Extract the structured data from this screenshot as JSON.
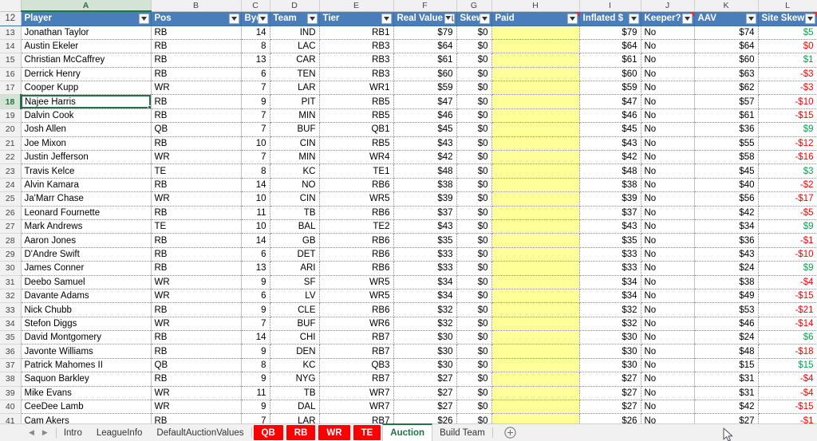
{
  "app": {
    "type": "spreadsheet",
    "selected_cell": "A18",
    "active_column": "A",
    "active_row": "18"
  },
  "colors": {
    "header_blue": "#4a7ebb",
    "paid_yellow": "#ffff99",
    "active_green": "#217346",
    "positive_green": "#00a550",
    "negative_red": "#ff0000",
    "tab_red": "#ff0000"
  },
  "column_letters": [
    "A",
    "B",
    "C",
    "D",
    "E",
    "F",
    "G",
    "H",
    "I",
    "J",
    "K",
    "L"
  ],
  "table": {
    "header_row_number": "12",
    "headers": [
      {
        "label": "Player",
        "filter": "dropdown",
        "comment": false
      },
      {
        "label": "Pos",
        "filter": "dropdown",
        "comment": false
      },
      {
        "label": "Bye",
        "filter": "dropdown",
        "comment": false
      },
      {
        "label": "Team",
        "filter": "dropdown",
        "comment": false
      },
      {
        "label": "Tier",
        "filter": "dropdown",
        "comment": false
      },
      {
        "label": "Real Value",
        "filter": "sort-desc",
        "comment": false
      },
      {
        "label": "Skew",
        "filter": "dropdown",
        "comment": false
      },
      {
        "label": "Paid",
        "filter": "dropdown",
        "comment": true
      },
      {
        "label": "Inflated $",
        "filter": "dropdown",
        "comment": false
      },
      {
        "label": "Keeper?",
        "filter": "dropdown",
        "comment": true
      },
      {
        "label": "AAV",
        "filter": "dropdown",
        "comment": false
      },
      {
        "label": "Site Skew",
        "filter": "dropdown",
        "comment": true
      }
    ],
    "rows": [
      {
        "n": "13",
        "player": "Jonathan Taylor",
        "pos": "RB",
        "bye": "14",
        "team": "IND",
        "tier": "RB1",
        "real": "$79",
        "skew": "$0",
        "paid": "",
        "inflated": "$79",
        "keeper": "No",
        "aav": "$74",
        "site_skew": "$5",
        "site_skew_sign": "pos"
      },
      {
        "n": "14",
        "player": "Austin Ekeler",
        "pos": "RB",
        "bye": "8",
        "team": "LAC",
        "tier": "RB3",
        "real": "$64",
        "skew": "$0",
        "paid": "",
        "inflated": "$64",
        "keeper": "No",
        "aav": "$64",
        "site_skew": "$0",
        "site_skew_sign": "neg"
      },
      {
        "n": "15",
        "player": "Christian McCaffrey",
        "pos": "RB",
        "bye": "13",
        "team": "CAR",
        "tier": "RB3",
        "real": "$61",
        "skew": "$0",
        "paid": "",
        "inflated": "$61",
        "keeper": "No",
        "aav": "$60",
        "site_skew": "$1",
        "site_skew_sign": "pos"
      },
      {
        "n": "16",
        "player": "Derrick Henry",
        "pos": "RB",
        "bye": "6",
        "team": "TEN",
        "tier": "RB3",
        "real": "$60",
        "skew": "$0",
        "paid": "",
        "inflated": "$60",
        "keeper": "No",
        "aav": "$63",
        "site_skew": "-$3",
        "site_skew_sign": "neg"
      },
      {
        "n": "17",
        "player": "Cooper Kupp",
        "pos": "WR",
        "bye": "7",
        "team": "LAR",
        "tier": "WR1",
        "real": "$59",
        "skew": "$0",
        "paid": "",
        "inflated": "$59",
        "keeper": "No",
        "aav": "$62",
        "site_skew": "-$3",
        "site_skew_sign": "neg"
      },
      {
        "n": "18",
        "player": "Najee Harris",
        "pos": "RB",
        "bye": "9",
        "team": "PIT",
        "tier": "RB5",
        "real": "$47",
        "skew": "$0",
        "paid": "",
        "inflated": "$47",
        "keeper": "No",
        "aav": "$57",
        "site_skew": "-$10",
        "site_skew_sign": "neg"
      },
      {
        "n": "19",
        "player": "Dalvin Cook",
        "pos": "RB",
        "bye": "7",
        "team": "MIN",
        "tier": "RB5",
        "real": "$46",
        "skew": "$0",
        "paid": "",
        "inflated": "$46",
        "keeper": "No",
        "aav": "$61",
        "site_skew": "-$15",
        "site_skew_sign": "neg"
      },
      {
        "n": "20",
        "player": "Josh Allen",
        "pos": "QB",
        "bye": "7",
        "team": "BUF",
        "tier": "QB1",
        "real": "$45",
        "skew": "$0",
        "paid": "",
        "inflated": "$45",
        "keeper": "No",
        "aav": "$36",
        "site_skew": "$9",
        "site_skew_sign": "pos"
      },
      {
        "n": "21",
        "player": "Joe Mixon",
        "pos": "RB",
        "bye": "10",
        "team": "CIN",
        "tier": "RB5",
        "real": "$43",
        "skew": "$0",
        "paid": "",
        "inflated": "$43",
        "keeper": "No",
        "aav": "$55",
        "site_skew": "-$12",
        "site_skew_sign": "neg"
      },
      {
        "n": "22",
        "player": "Justin Jefferson",
        "pos": "WR",
        "bye": "7",
        "team": "MIN",
        "tier": "WR4",
        "real": "$42",
        "skew": "$0",
        "paid": "",
        "inflated": "$42",
        "keeper": "No",
        "aav": "$58",
        "site_skew": "-$16",
        "site_skew_sign": "neg"
      },
      {
        "n": "23",
        "player": "Travis Kelce",
        "pos": "TE",
        "bye": "8",
        "team": "KC",
        "tier": "TE1",
        "real": "$48",
        "skew": "$0",
        "paid": "",
        "inflated": "$48",
        "keeper": "No",
        "aav": "$45",
        "site_skew": "$3",
        "site_skew_sign": "pos"
      },
      {
        "n": "24",
        "player": "Alvin Kamara",
        "pos": "RB",
        "bye": "14",
        "team": "NO",
        "tier": "RB6",
        "real": "$38",
        "skew": "$0",
        "paid": "",
        "inflated": "$38",
        "keeper": "No",
        "aav": "$40",
        "site_skew": "-$2",
        "site_skew_sign": "neg"
      },
      {
        "n": "25",
        "player": "Ja'Marr Chase",
        "pos": "WR",
        "bye": "10",
        "team": "CIN",
        "tier": "WR5",
        "real": "$39",
        "skew": "$0",
        "paid": "",
        "inflated": "$39",
        "keeper": "No",
        "aav": "$56",
        "site_skew": "-$17",
        "site_skew_sign": "neg"
      },
      {
        "n": "26",
        "player": "Leonard Fournette",
        "pos": "RB",
        "bye": "11",
        "team": "TB",
        "tier": "RB6",
        "real": "$37",
        "skew": "$0",
        "paid": "",
        "inflated": "$37",
        "keeper": "No",
        "aav": "$42",
        "site_skew": "-$5",
        "site_skew_sign": "neg"
      },
      {
        "n": "27",
        "player": "Mark Andrews",
        "pos": "TE",
        "bye": "10",
        "team": "BAL",
        "tier": "TE2",
        "real": "$43",
        "skew": "$0",
        "paid": "",
        "inflated": "$43",
        "keeper": "No",
        "aav": "$34",
        "site_skew": "$9",
        "site_skew_sign": "pos"
      },
      {
        "n": "28",
        "player": "Aaron Jones",
        "pos": "RB",
        "bye": "14",
        "team": "GB",
        "tier": "RB6",
        "real": "$35",
        "skew": "$0",
        "paid": "",
        "inflated": "$35",
        "keeper": "No",
        "aav": "$36",
        "site_skew": "-$1",
        "site_skew_sign": "neg"
      },
      {
        "n": "29",
        "player": "D'Andre Swift",
        "pos": "RB",
        "bye": "6",
        "team": "DET",
        "tier": "RB6",
        "real": "$33",
        "skew": "$0",
        "paid": "",
        "inflated": "$33",
        "keeper": "No",
        "aav": "$43",
        "site_skew": "-$10",
        "site_skew_sign": "neg"
      },
      {
        "n": "30",
        "player": "James Conner",
        "pos": "RB",
        "bye": "13",
        "team": "ARI",
        "tier": "RB6",
        "real": "$33",
        "skew": "$0",
        "paid": "",
        "inflated": "$33",
        "keeper": "No",
        "aav": "$24",
        "site_skew": "$9",
        "site_skew_sign": "pos"
      },
      {
        "n": "31",
        "player": "Deebo Samuel",
        "pos": "WR",
        "bye": "9",
        "team": "SF",
        "tier": "WR5",
        "real": "$34",
        "skew": "$0",
        "paid": "",
        "inflated": "$34",
        "keeper": "No",
        "aav": "$38",
        "site_skew": "-$4",
        "site_skew_sign": "neg"
      },
      {
        "n": "32",
        "player": "Davante Adams",
        "pos": "WR",
        "bye": "6",
        "team": "LV",
        "tier": "WR5",
        "real": "$34",
        "skew": "$0",
        "paid": "",
        "inflated": "$34",
        "keeper": "No",
        "aav": "$49",
        "site_skew": "-$15",
        "site_skew_sign": "neg"
      },
      {
        "n": "33",
        "player": "Nick Chubb",
        "pos": "RB",
        "bye": "9",
        "team": "CLE",
        "tier": "RB6",
        "real": "$32",
        "skew": "$0",
        "paid": "",
        "inflated": "$32",
        "keeper": "No",
        "aav": "$53",
        "site_skew": "-$21",
        "site_skew_sign": "neg"
      },
      {
        "n": "34",
        "player": "Stefon Diggs",
        "pos": "WR",
        "bye": "7",
        "team": "BUF",
        "tier": "WR6",
        "real": "$32",
        "skew": "$0",
        "paid": "",
        "inflated": "$32",
        "keeper": "No",
        "aav": "$46",
        "site_skew": "-$14",
        "site_skew_sign": "neg"
      },
      {
        "n": "35",
        "player": "David Montgomery",
        "pos": "RB",
        "bye": "14",
        "team": "CHI",
        "tier": "RB7",
        "real": "$30",
        "skew": "$0",
        "paid": "",
        "inflated": "$30",
        "keeper": "No",
        "aav": "$24",
        "site_skew": "$6",
        "site_skew_sign": "pos"
      },
      {
        "n": "36",
        "player": "Javonte Williams",
        "pos": "RB",
        "bye": "9",
        "team": "DEN",
        "tier": "RB7",
        "real": "$30",
        "skew": "$0",
        "paid": "",
        "inflated": "$30",
        "keeper": "No",
        "aav": "$48",
        "site_skew": "-$18",
        "site_skew_sign": "neg"
      },
      {
        "n": "37",
        "player": "Patrick Mahomes II",
        "pos": "QB",
        "bye": "8",
        "team": "KC",
        "tier": "QB3",
        "real": "$30",
        "skew": "$0",
        "paid": "",
        "inflated": "$30",
        "keeper": "No",
        "aav": "$15",
        "site_skew": "$15",
        "site_skew_sign": "pos"
      },
      {
        "n": "38",
        "player": "Saquon Barkley",
        "pos": "RB",
        "bye": "9",
        "team": "NYG",
        "tier": "RB7",
        "real": "$27",
        "skew": "$0",
        "paid": "",
        "inflated": "$27",
        "keeper": "No",
        "aav": "$31",
        "site_skew": "-$4",
        "site_skew_sign": "neg"
      },
      {
        "n": "39",
        "player": "Mike Evans",
        "pos": "WR",
        "bye": "11",
        "team": "TB",
        "tier": "WR7",
        "real": "$27",
        "skew": "$0",
        "paid": "",
        "inflated": "$27",
        "keeper": "No",
        "aav": "$31",
        "site_skew": "-$4",
        "site_skew_sign": "neg"
      },
      {
        "n": "40",
        "player": "CeeDee Lamb",
        "pos": "WR",
        "bye": "9",
        "team": "DAL",
        "tier": "WR7",
        "real": "$27",
        "skew": "$0",
        "paid": "",
        "inflated": "$27",
        "keeper": "No",
        "aav": "$42",
        "site_skew": "-$15",
        "site_skew_sign": "neg"
      },
      {
        "n": "41",
        "player": "Cam Akers",
        "pos": "RB",
        "bye": "7",
        "team": "LAR",
        "tier": "RB7",
        "real": "$26",
        "skew": "$0",
        "paid": "",
        "inflated": "$26",
        "keeper": "No",
        "aav": "$27",
        "site_skew": "-$1",
        "site_skew_sign": "neg"
      }
    ]
  },
  "sheet_tabs": {
    "nav_prev": "◀",
    "nav_next": "▶",
    "items": [
      {
        "label": "Intro",
        "style": "normal",
        "active": false
      },
      {
        "label": "LeagueInfo",
        "style": "normal",
        "active": false
      },
      {
        "label": "DefaultAuctionValues",
        "style": "normal",
        "active": false
      },
      {
        "label": "QB",
        "style": "red",
        "active": false
      },
      {
        "label": "RB",
        "style": "red",
        "active": false
      },
      {
        "label": "WR",
        "style": "red",
        "active": false
      },
      {
        "label": "TE",
        "style": "red",
        "active": false
      },
      {
        "label": "Auction",
        "style": "normal",
        "active": true
      },
      {
        "label": "Build Team",
        "style": "normal",
        "active": false
      }
    ],
    "add_sheet": "add-sheet"
  }
}
